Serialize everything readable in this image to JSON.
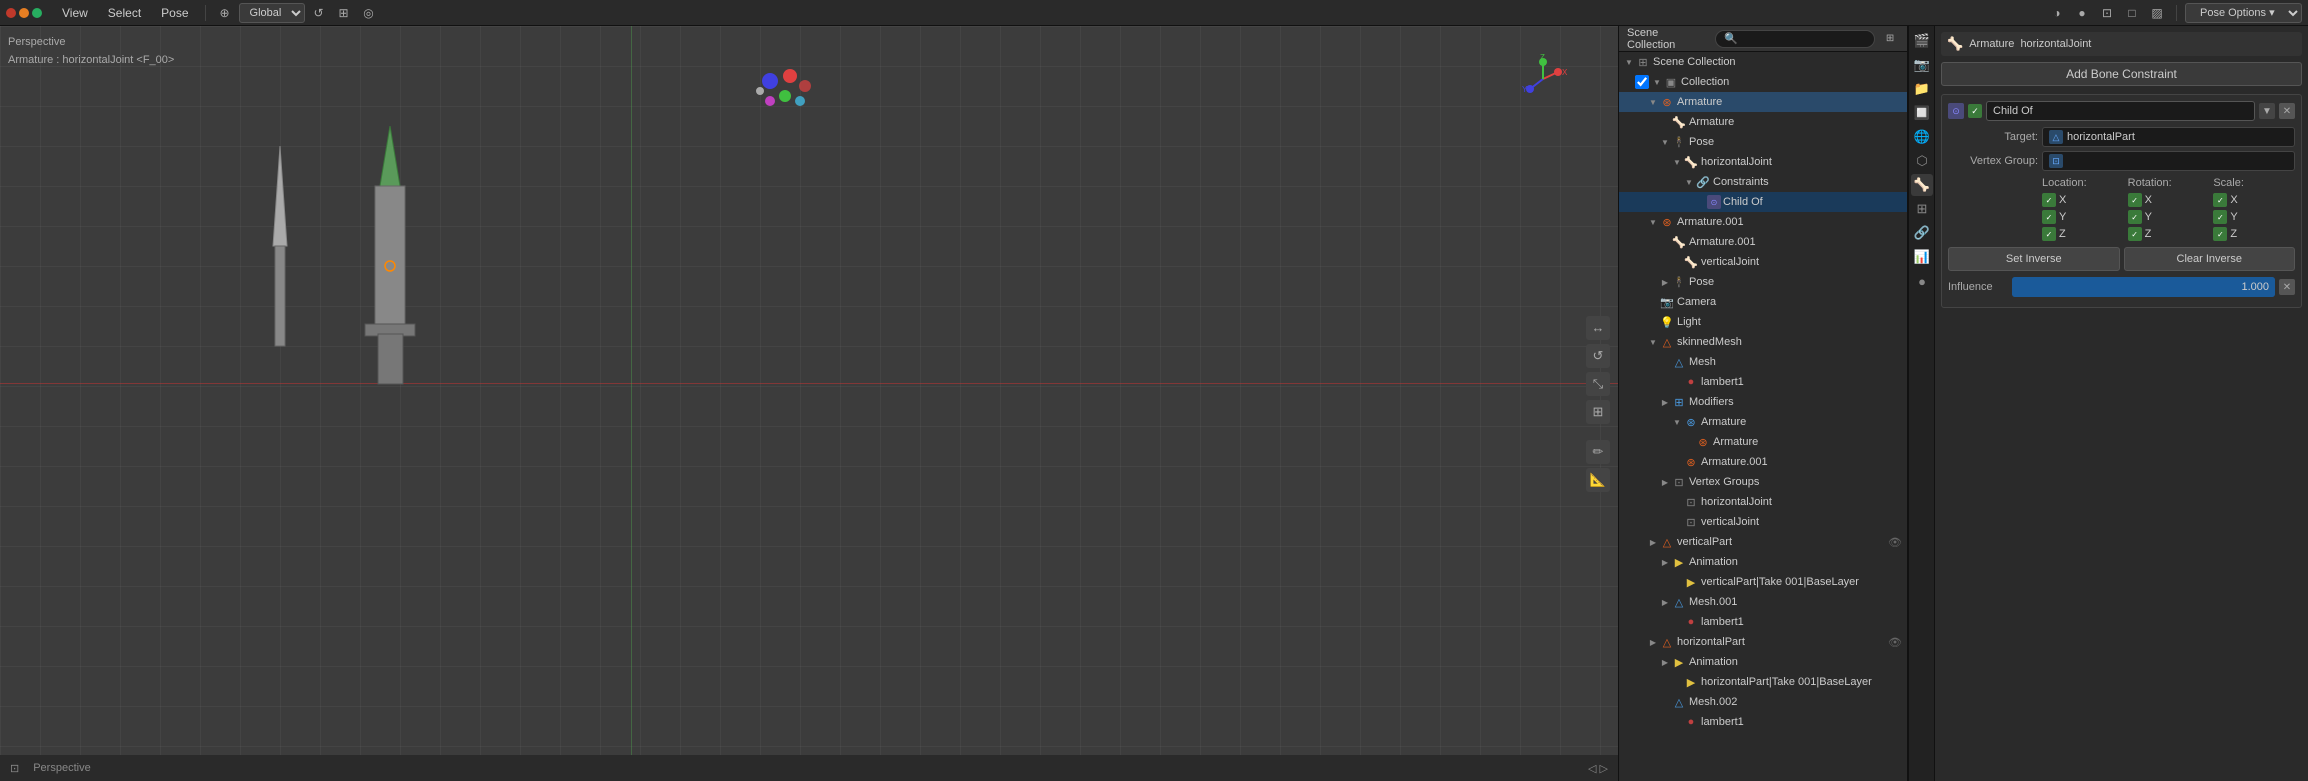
{
  "topbar": {
    "menus": [
      "View",
      "Select",
      "Pose"
    ],
    "global_label": "Global",
    "pose_options_label": "Pose Options ▾"
  },
  "viewport": {
    "info_line1": "Perspective",
    "info_line2": "Armature : horizontalJoint <F_00>",
    "cursor_symbol": "⊕"
  },
  "outliner": {
    "title": "Scene Collection",
    "search_placeholder": "🔍",
    "items": [
      {
        "id": "collection",
        "label": "Collection",
        "level": 1,
        "icon": "▼",
        "type": "folder",
        "has_eye": false,
        "checked": true
      },
      {
        "id": "armature",
        "label": "Armature",
        "level": 2,
        "icon": "▶",
        "type": "armature",
        "has_eye": false,
        "selected": true
      },
      {
        "id": "armature-sub",
        "label": "Armature",
        "level": 3,
        "icon": "",
        "type": "armature-data",
        "has_eye": false
      },
      {
        "id": "pose",
        "label": "Pose",
        "level": 3,
        "icon": "▶",
        "type": "pose",
        "has_eye": false
      },
      {
        "id": "horizontalJoint",
        "label": "horizontalJoint",
        "level": 4,
        "icon": "▼",
        "type": "bone",
        "has_eye": false
      },
      {
        "id": "constraints",
        "label": "Constraints",
        "level": 5,
        "icon": "▼",
        "type": "constraint-group",
        "has_eye": false
      },
      {
        "id": "child-of",
        "label": "Child Of",
        "level": 6,
        "icon": "",
        "type": "constraint",
        "has_eye": false
      },
      {
        "id": "armature001",
        "label": "Armature.001",
        "level": 2,
        "icon": "▶",
        "type": "armature",
        "has_eye": false
      },
      {
        "id": "armature001-sub",
        "label": "Armature.001",
        "level": 3,
        "icon": "",
        "type": "armature-data",
        "has_eye": false
      },
      {
        "id": "verticaljoint",
        "label": "verticalJoint",
        "level": 4,
        "icon": "",
        "type": "bone",
        "has_eye": false
      },
      {
        "id": "pose-sub",
        "label": "Pose",
        "level": 3,
        "icon": "▶",
        "type": "pose",
        "has_eye": false
      },
      {
        "id": "camera",
        "label": "Camera",
        "level": 2,
        "icon": "",
        "type": "camera",
        "has_eye": false
      },
      {
        "id": "light",
        "label": "Light",
        "level": 2,
        "icon": "",
        "type": "light",
        "has_eye": false
      },
      {
        "id": "skinnedmesh",
        "label": "skinnedMesh",
        "level": 2,
        "icon": "▶",
        "type": "mesh-obj",
        "has_eye": false
      },
      {
        "id": "mesh",
        "label": "Mesh",
        "level": 3,
        "icon": "",
        "type": "mesh-data",
        "has_eye": false
      },
      {
        "id": "lambert1",
        "label": "lambert1",
        "level": 4,
        "icon": "",
        "type": "material",
        "has_eye": false
      },
      {
        "id": "modifiers",
        "label": "Modifiers",
        "level": 3,
        "icon": "▶",
        "type": "modifier-group",
        "has_eye": false
      },
      {
        "id": "mod-armature",
        "label": "Armature",
        "level": 4,
        "icon": "▼",
        "type": "modifier",
        "has_eye": false
      },
      {
        "id": "mod-armature-ref",
        "label": "Armature",
        "level": 5,
        "icon": "",
        "type": "armature-ref",
        "has_eye": false
      },
      {
        "id": "armature001-ref",
        "label": "Armature.001",
        "level": 4,
        "icon": "",
        "type": "armature-ref",
        "has_eye": false
      },
      {
        "id": "vertex-groups",
        "label": "Vertex Groups",
        "level": 3,
        "icon": "▶",
        "type": "vgroup-group",
        "has_eye": false
      },
      {
        "id": "horizontalJoint-vg",
        "label": "horizontalJoint",
        "level": 4,
        "icon": "",
        "type": "vgroup",
        "has_eye": false
      },
      {
        "id": "verticalJoint-vg",
        "label": "verticalJoint",
        "level": 4,
        "icon": "",
        "type": "vgroup",
        "has_eye": false
      },
      {
        "id": "verticalPart",
        "label": "verticalPart",
        "level": 2,
        "icon": "▶",
        "type": "mesh-obj",
        "has_eye": true
      },
      {
        "id": "animation-vp",
        "label": "Animation",
        "level": 3,
        "icon": "▶",
        "type": "anim",
        "has_eye": false
      },
      {
        "id": "verticalPart-anim",
        "label": "verticalPart|Take 001|BaseLayer",
        "level": 4,
        "icon": "",
        "type": "anim-clip",
        "has_eye": false
      },
      {
        "id": "mesh001",
        "label": "Mesh.001",
        "level": 3,
        "icon": "▶",
        "type": "mesh-data",
        "has_eye": false
      },
      {
        "id": "lambert1-sub",
        "label": "lambert1",
        "level": 4,
        "icon": "",
        "type": "material",
        "has_eye": false
      },
      {
        "id": "horizontalPart",
        "label": "horizontalPart",
        "level": 2,
        "icon": "▶",
        "type": "mesh-obj",
        "has_eye": true
      },
      {
        "id": "animation-hp",
        "label": "Animation",
        "level": 3,
        "icon": "▶",
        "type": "anim",
        "has_eye": false
      },
      {
        "id": "horizontalPart-anim",
        "label": "horizontalPart|Take 001|BaseLayer",
        "level": 4,
        "icon": "",
        "type": "anim-clip",
        "has_eye": false
      },
      {
        "id": "mesh002",
        "label": "Mesh.002",
        "level": 3,
        "icon": "",
        "type": "mesh-data",
        "has_eye": false
      },
      {
        "id": "lambert1-sub2",
        "label": "lambert1",
        "level": 4,
        "icon": "",
        "type": "material",
        "has_eye": false
      }
    ]
  },
  "properties": {
    "title": "Add Bone Constraint",
    "constraint_title": "Child Of",
    "target_label": "Target:",
    "target_value": "horizontalPart",
    "vertex_group_label": "Vertex Group:",
    "location_label": "Location:",
    "rotation_label": "Rotation:",
    "scale_label": "Scale:",
    "axes": {
      "location": [
        "X",
        "Y",
        "Z"
      ],
      "rotation": [
        "X",
        "Y",
        "Z"
      ],
      "scale": [
        "X",
        "Y",
        "Z"
      ]
    },
    "set_inverse_label": "Set Inverse",
    "clear_inverse_label": "Clear Inverse",
    "influence_label": "Influence",
    "influence_value": "1.000"
  }
}
